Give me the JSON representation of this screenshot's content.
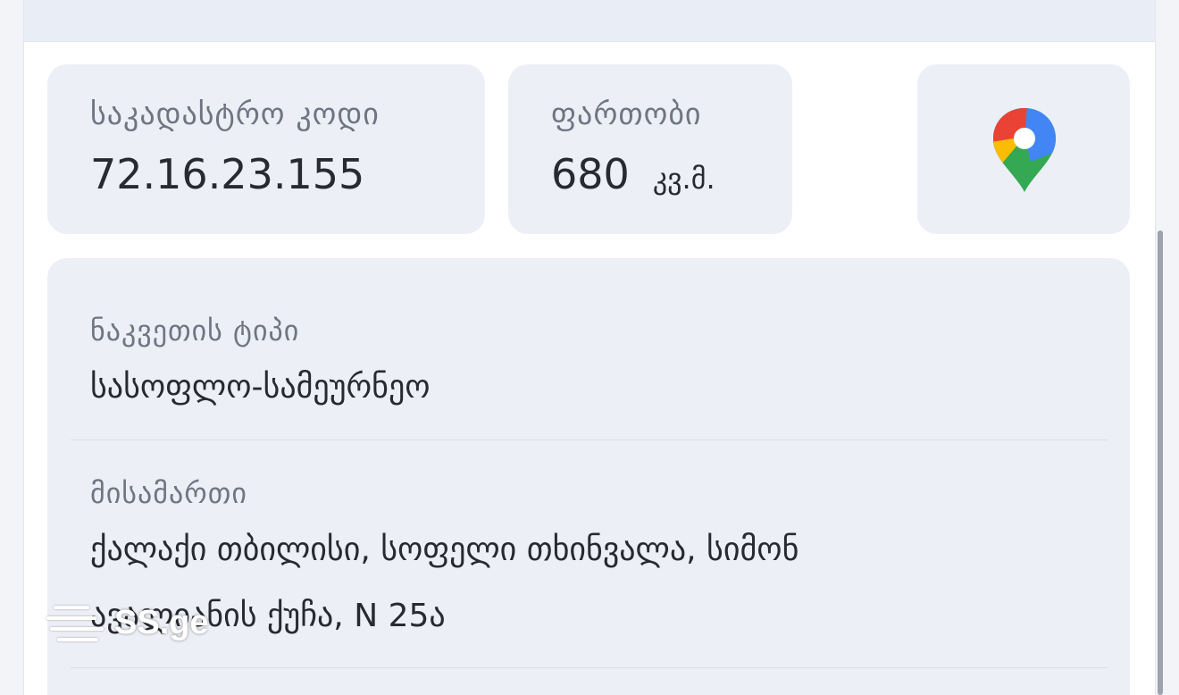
{
  "cards": {
    "cadastral": {
      "label": "საკადასტრო კოდი",
      "value": "72.16.23.155"
    },
    "area": {
      "label": "ფართობი",
      "value": "680",
      "unit": "კვ.მ."
    },
    "map": {
      "icon": "google-maps-pin-icon"
    }
  },
  "details": {
    "plot_type": {
      "label": "ნაკვეთის ტიპი",
      "value": "სასოფლო-სამეურნეო"
    },
    "address": {
      "label": "მისამართი",
      "line1": "ქალაქი თბილისი, სოფელი თხინვალა, სიმონ",
      "line2": "ავალიანის ქუჩა, N 25ა"
    }
  },
  "watermark": {
    "text": "SS.ge"
  },
  "colors": {
    "card_bg": "#eceff6",
    "label": "#6f7581",
    "value": "#272a31"
  }
}
